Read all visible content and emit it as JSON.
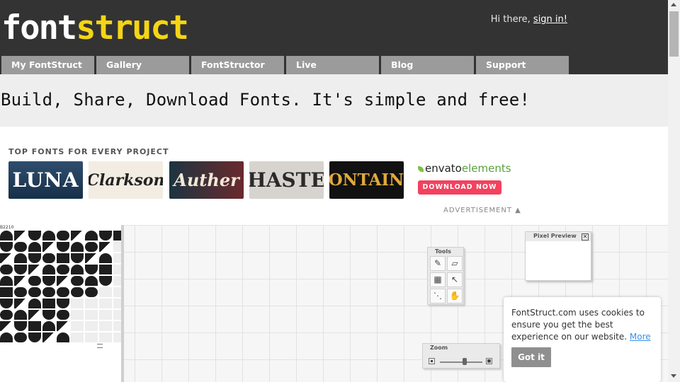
{
  "header": {
    "logo_part1": "font",
    "logo_part2": "struct",
    "greeting": "Hi there,",
    "signin_label": "sign in!"
  },
  "nav": {
    "items": [
      "My FontStruct",
      "Gallery",
      "FontStructor",
      "Live",
      "Blog",
      "Support"
    ]
  },
  "tagline": "Build, Share, Download Fonts. It's simple and free!",
  "ad": {
    "title": "TOP FONTS FOR EVERY PROJECT",
    "tiles": [
      "LUNA",
      "Clarkson",
      "Auther",
      "HASTE",
      "FONTAINE"
    ],
    "brand_part1": "envato",
    "brand_part2": "elements",
    "cta": "DOWNLOAD NOW",
    "advertisement_label": "ADVERTISEMENT ▲"
  },
  "editor": {
    "glyph_panel_label": "B2210",
    "tools_title": "Tools",
    "tools": [
      "✎",
      "▱",
      "▦",
      "↖",
      "⋱",
      "✋"
    ],
    "pixel_preview_title": "Pixel Preview",
    "zoom_title": "Zoom"
  },
  "cookie": {
    "message": "FontStruct.com uses cookies to ensure you get the best experience on our website.",
    "more_label": "More",
    "button_label": "Got it"
  },
  "colors": {
    "header_bg": "#333333",
    "logo_accent": "#f5d515",
    "nav_bg": "#9b9b9b",
    "cta_pink": "#f3415e",
    "envato_green": "#7cc245"
  }
}
